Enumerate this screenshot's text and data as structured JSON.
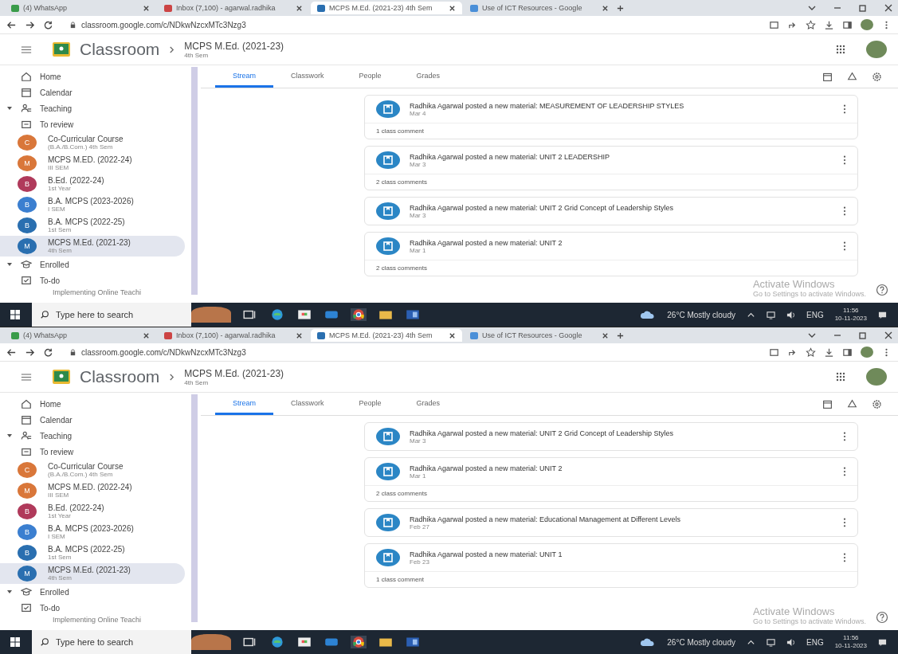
{
  "screens": [
    {
      "browser_tabs": [
        {
          "title": "(4) WhatsApp",
          "selected": false
        },
        {
          "title": "Inbox (7,100) - agarwal.radhika",
          "selected": false
        },
        {
          "title": "MCPS M.Ed. (2021-23) 4th Sem",
          "selected": true
        },
        {
          "title": "Use of ICT Resources - Google",
          "selected": false
        }
      ],
      "url": "classroom.google.com/c/NDkwNzcxMTc3Nzg3",
      "app": {
        "name": "Classroom",
        "class_title": "MCPS M.Ed. (2021-23)",
        "class_subtitle": "4th Sem"
      },
      "nav_tabs": [
        {
          "label": "Stream",
          "selected": true
        },
        {
          "label": "Classwork",
          "selected": false
        },
        {
          "label": "People",
          "selected": false
        },
        {
          "label": "Grades",
          "selected": false
        }
      ],
      "sidebar": [
        {
          "kind": "home",
          "label": "Home"
        },
        {
          "kind": "calendar",
          "label": "Calendar"
        },
        {
          "kind": "teaching",
          "label": "Teaching",
          "expanded": true
        },
        {
          "kind": "review",
          "label": "To review"
        },
        {
          "kind": "class",
          "label": "Co-Curricular Course",
          "sublabel": "(B.A./B.Com.) 4th Sem",
          "letter": "C",
          "color": "#d9773a",
          "selected": false
        },
        {
          "kind": "class",
          "label": "MCPS M.ED. (2022-24)",
          "sublabel": "III SEM",
          "letter": "M",
          "color": "#d9773a",
          "selected": false
        },
        {
          "kind": "class",
          "label": "B.Ed. (2022-24)",
          "sublabel": "1st Year",
          "letter": "B",
          "color": "#b03a5b",
          "selected": false
        },
        {
          "kind": "class",
          "label": "B.A. MCPS (2023-2026)",
          "sublabel": "I SEM",
          "letter": "B",
          "color": "#3b7fd0",
          "selected": false
        },
        {
          "kind": "class",
          "label": "B.A. MCPS (2022-25)",
          "sublabel": "1st Sem",
          "letter": "B",
          "color": "#2a6fb0",
          "selected": false
        },
        {
          "kind": "class",
          "label": "MCPS M.Ed. (2021-23)",
          "sublabel": "4th Sem",
          "letter": "M",
          "color": "#2a6fb0",
          "selected": true
        },
        {
          "kind": "enrolled",
          "label": "Enrolled",
          "expanded": true
        },
        {
          "kind": "todo",
          "label": "To-do"
        },
        {
          "kind": "cut",
          "label": "Implementing Online Teachi"
        }
      ],
      "posts": [
        {
          "text": "Radhika Agarwal posted a new material: MEASUREMENT OF LEADERSHIP STYLES",
          "date": "Mar 4",
          "comments": "1 class comment"
        },
        {
          "text": "Radhika Agarwal posted a new material: UNIT 2 LEADERSHIP",
          "date": "Mar 3",
          "comments": "2 class comments"
        },
        {
          "text": "Radhika Agarwal posted a new material: UNIT 2 Grid Concept of Leadership Styles",
          "date": "Mar 3"
        },
        {
          "text": "Radhika Agarwal posted a new material: UNIT 2",
          "date": "Mar 1",
          "comments": "2 class comments"
        }
      ],
      "activation": {
        "title": "Activate Windows",
        "subtitle": "Go to Settings to activate Windows."
      },
      "taskbar": {
        "search_placeholder": "Type here to search",
        "weather": "26°C Mostly cloudy",
        "language": "ENG",
        "time": "11:56",
        "date": "10-11-2023"
      }
    },
    {
      "browser_tabs": [
        {
          "title": "(4) WhatsApp",
          "selected": false
        },
        {
          "title": "Inbox (7,100) - agarwal.radhika",
          "selected": false
        },
        {
          "title": "MCPS M.Ed. (2021-23) 4th Sem",
          "selected": true
        },
        {
          "title": "Use of ICT Resources - Google",
          "selected": false
        }
      ],
      "url": "classroom.google.com/c/NDkwNzcxMTc3Nzg3",
      "app": {
        "name": "Classroom",
        "class_title": "MCPS M.Ed. (2021-23)",
        "class_subtitle": "4th Sem"
      },
      "nav_tabs": [
        {
          "label": "Stream",
          "selected": true
        },
        {
          "label": "Classwork",
          "selected": false
        },
        {
          "label": "People",
          "selected": false
        },
        {
          "label": "Grades",
          "selected": false
        }
      ],
      "sidebar": [
        {
          "kind": "home",
          "label": "Home"
        },
        {
          "kind": "calendar",
          "label": "Calendar"
        },
        {
          "kind": "teaching",
          "label": "Teaching",
          "expanded": true
        },
        {
          "kind": "review",
          "label": "To review"
        },
        {
          "kind": "class",
          "label": "Co-Curricular Course",
          "sublabel": "(B.A./B.Com.) 4th Sem",
          "letter": "C",
          "color": "#d9773a",
          "selected": false
        },
        {
          "kind": "class",
          "label": "MCPS M.ED. (2022-24)",
          "sublabel": "III SEM",
          "letter": "M",
          "color": "#d9773a",
          "selected": false
        },
        {
          "kind": "class",
          "label": "B.Ed. (2022-24)",
          "sublabel": "1st Year",
          "letter": "B",
          "color": "#b03a5b",
          "selected": false
        },
        {
          "kind": "class",
          "label": "B.A. MCPS (2023-2026)",
          "sublabel": "I SEM",
          "letter": "B",
          "color": "#3b7fd0",
          "selected": false
        },
        {
          "kind": "class",
          "label": "B.A. MCPS (2022-25)",
          "sublabel": "1st Sem",
          "letter": "B",
          "color": "#2a6fb0",
          "selected": false
        },
        {
          "kind": "class",
          "label": "MCPS M.Ed. (2021-23)",
          "sublabel": "4th Sem",
          "letter": "M",
          "color": "#2a6fb0",
          "selected": true
        },
        {
          "kind": "enrolled",
          "label": "Enrolled",
          "expanded": true
        },
        {
          "kind": "todo",
          "label": "To-do"
        },
        {
          "kind": "cut",
          "label": "Implementing Online Teachi"
        }
      ],
      "posts": [
        {
          "text": "Radhika Agarwal posted a new material: UNIT 2 Grid Concept of Leadership Styles",
          "date": "Mar 3"
        },
        {
          "text": "Radhika Agarwal posted a new material: UNIT 2",
          "date": "Mar 1",
          "comments": "2 class comments"
        },
        {
          "text": "Radhika Agarwal posted a new material: Educational Management at Different Levels",
          "date": "Feb 27"
        },
        {
          "text": "Radhika Agarwal posted a new material: UNIT 1",
          "date": "Feb 23",
          "comments": "1 class comment"
        }
      ],
      "activation": {
        "title": "Activate Windows",
        "subtitle": "Go to Settings to activate Windows."
      },
      "taskbar": {
        "search_placeholder": "Type here to search",
        "weather": "26°C Mostly cloudy",
        "language": "ENG",
        "time": "11:56",
        "date": "10-11-2023"
      }
    }
  ]
}
